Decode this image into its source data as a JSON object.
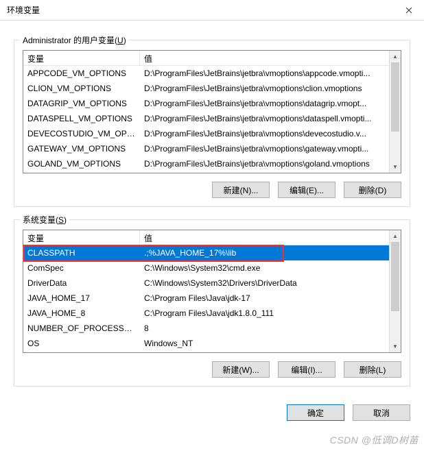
{
  "window": {
    "title": "环境变量"
  },
  "user_vars": {
    "group_label": "Administrator 的用户变量",
    "group_accel": "U",
    "col_name": "变量",
    "col_value": "值",
    "rows": [
      {
        "name": "APPCODE_VM_OPTIONS",
        "value": "D:\\ProgramFiles\\JetBrains\\jetbra\\vmoptions\\appcode.vmopti..."
      },
      {
        "name": "CLION_VM_OPTIONS",
        "value": "D:\\ProgramFiles\\JetBrains\\jetbra\\vmoptions\\clion.vmoptions"
      },
      {
        "name": "DATAGRIP_VM_OPTIONS",
        "value": "D:\\ProgramFiles\\JetBrains\\jetbra\\vmoptions\\datagrip.vmopt..."
      },
      {
        "name": "DATASPELL_VM_OPTIONS",
        "value": "D:\\ProgramFiles\\JetBrains\\jetbra\\vmoptions\\dataspell.vmopti..."
      },
      {
        "name": "DEVECOSTUDIO_VM_OPT...",
        "value": "D:\\ProgramFiles\\JetBrains\\jetbra\\vmoptions\\devecostudio.v..."
      },
      {
        "name": "GATEWAY_VM_OPTIONS",
        "value": "D:\\ProgramFiles\\JetBrains\\jetbra\\vmoptions\\gateway.vmopti..."
      },
      {
        "name": "GOLAND_VM_OPTIONS",
        "value": "D:\\ProgramFiles\\JetBrains\\jetbra\\vmoptions\\goland.vmoptions"
      }
    ],
    "buttons": {
      "new": "新建(N)...",
      "edit": "编辑(E)...",
      "del": "删除(D)"
    }
  },
  "sys_vars": {
    "group_label": "系统变量",
    "group_accel": "S",
    "col_name": "变量",
    "col_value": "值",
    "rows": [
      {
        "name": "CLASSPATH",
        "value": ".;%JAVA_HOME_17%\\lib",
        "selected": true
      },
      {
        "name": "ComSpec",
        "value": "C:\\Windows\\System32\\cmd.exe"
      },
      {
        "name": "DriverData",
        "value": "C:\\Windows\\System32\\Drivers\\DriverData"
      },
      {
        "name": "JAVA_HOME_17",
        "value": "C:\\Program Files\\Java\\jdk-17"
      },
      {
        "name": "JAVA_HOME_8",
        "value": "C:\\Program Files\\Java\\jdk1.8.0_111"
      },
      {
        "name": "NUMBER_OF_PROCESSORS",
        "value": "8"
      },
      {
        "name": "OS",
        "value": "Windows_NT"
      }
    ],
    "buttons": {
      "new": "新建(W)...",
      "edit": "编辑(I)...",
      "del": "删除(L)"
    }
  },
  "dialog_buttons": {
    "ok": "确定",
    "cancel": "取消"
  },
  "watermark": "CSDN @低调D树苗"
}
